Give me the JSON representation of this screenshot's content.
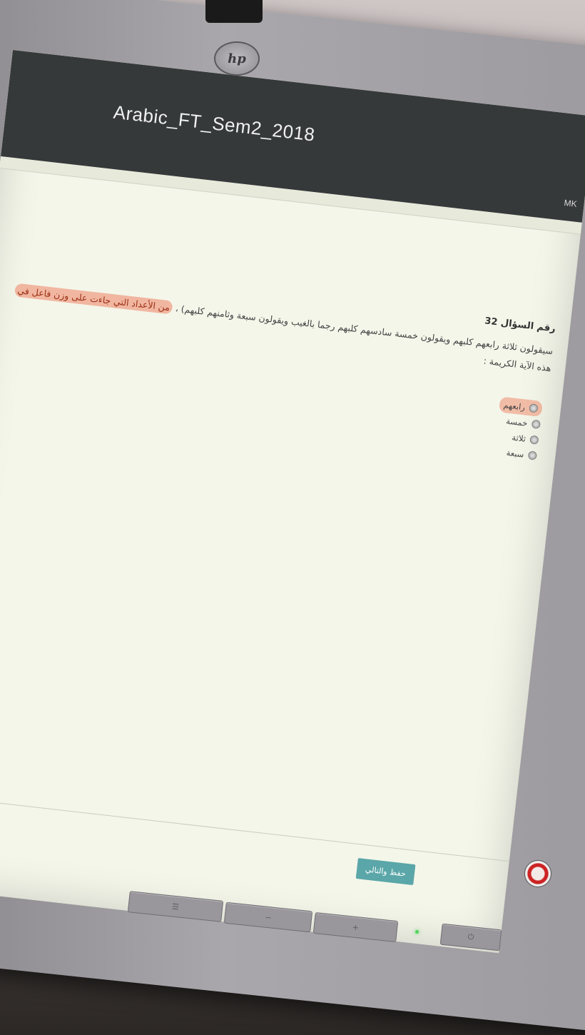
{
  "monitor": {
    "brand": "hp"
  },
  "window": {
    "exam_title": "Arabic_FT_Sem2_2018",
    "user_initials": "MK"
  },
  "question": {
    "number_label": "رقم السؤال 32",
    "text_start": "سيقولون ثلاثة رابعهم كلبهم ويقولون خمسة سادسهم كلبهم رجما بالغيب ويقولون سبعة وثامنهم كلبهم) ، ",
    "text_highlight": "من الأعداد التي جاءت على وزن فاعل في",
    "text_end": " هذه الآية الكريمة :"
  },
  "options": [
    {
      "label": "رابعهم",
      "marked": true
    },
    {
      "label": "خمسة",
      "marked": false
    },
    {
      "label": "ثلاثة",
      "marked": false
    },
    {
      "label": "سبعة",
      "marked": false
    }
  ],
  "actions": {
    "save_next_label": "حفظ والتالي"
  }
}
